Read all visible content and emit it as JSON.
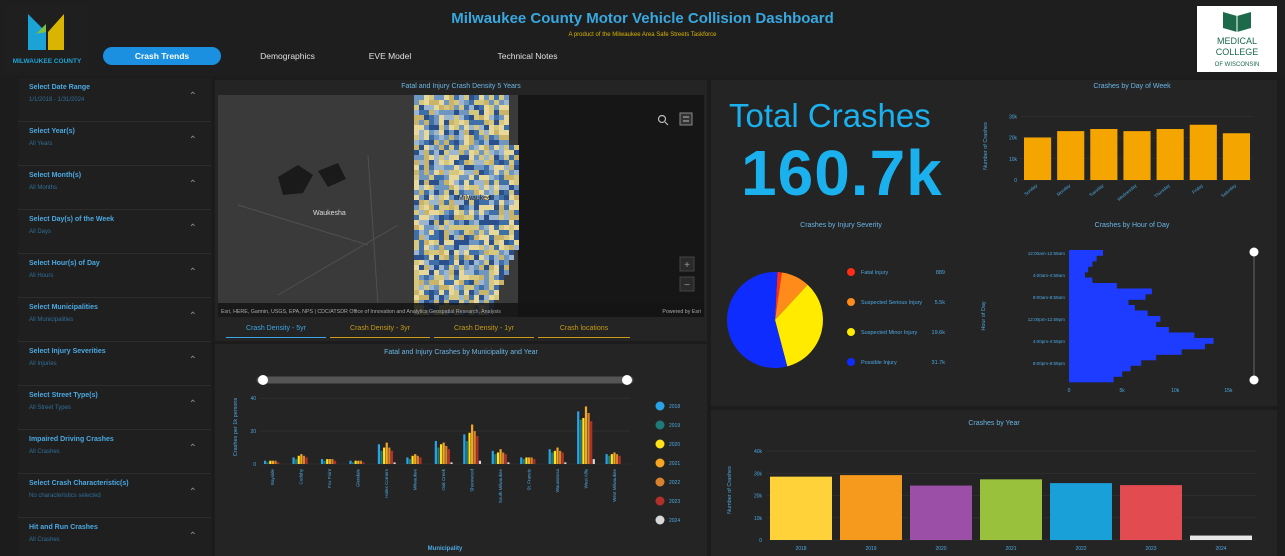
{
  "header": {
    "title": "Milwaukee County Motor Vehicle Collision Dashboard",
    "subtitle": "A product of the Milwaukee Area Safe Streets Taskforce",
    "left_logo_text": "MILWAUKEE COUNTY",
    "right_logo_text": "MEDICAL COLLEGE OF WISCONSIN",
    "tabs": [
      {
        "label": "Crash Trends",
        "active": true
      },
      {
        "label": "Demographics",
        "active": false
      },
      {
        "label": "EVE Model",
        "active": false
      },
      {
        "label": "Technical Notes",
        "active": false
      }
    ]
  },
  "sidebar": {
    "filters": [
      {
        "label": "Select Date Range",
        "value": "1/1/2018 - 1/31/2024"
      },
      {
        "label": "Select Year(s)",
        "value": "All Years"
      },
      {
        "label": "Select Month(s)",
        "value": "All Months"
      },
      {
        "label": "Select Day(s) of the Week",
        "value": "All Days"
      },
      {
        "label": "Select Hour(s) of Day",
        "value": "All Hours"
      },
      {
        "label": "Select Municipalities",
        "value": "All Municipalities"
      },
      {
        "label": "Select Injury Severities",
        "value": "All Injuries"
      },
      {
        "label": "Select Street Type(s)",
        "value": "All Street Types"
      },
      {
        "label": "Impaired Driving Crashes",
        "value": "All Crashes"
      },
      {
        "label": "Select Crash Characteristic(s)",
        "value": "No characteristics selected"
      },
      {
        "label": "Hit and Run Crashes",
        "value": "All Crashes"
      }
    ]
  },
  "map": {
    "title": "Fatal and Injury Crash Density 5 Years",
    "place_waukesha": "Waukesha",
    "place_milwaukee": "Milwaukee",
    "attribution": "Esri, HERE, Garmin, USGS, EPA, NPS | CDC/ATSDR Office of Innovation and Analytics Geospatial Research, Analysis",
    "powered_by": "Powered by Esri",
    "zoom_in": "+",
    "zoom_out": "−",
    "tabs": [
      {
        "label": "Crash Density - 5yr",
        "active": true
      },
      {
        "label": "Crash Density - 3yr",
        "active": false
      },
      {
        "label": "Crash Density - 1yr",
        "active": false
      },
      {
        "label": "Crash locations",
        "active": false
      }
    ]
  },
  "total": {
    "label": "Total Crashes",
    "value": "160.7k"
  },
  "colors": {
    "accent": "#1b8fe0",
    "orange": "#f5a500",
    "blue_bar": "#1e3cff",
    "yellow": "#ffeb00"
  },
  "charts": {
    "day_of_week": {
      "title": "Crashes by Day of Week",
      "ylabel": "Number of Crashes",
      "yticks": [
        "0",
        "10k",
        "20k",
        "30k"
      ],
      "ylim": [
        0,
        32
      ],
      "categories": [
        "Sunday",
        "Monday",
        "Tuesday",
        "Wednesday",
        "Thursday",
        "Friday",
        "Saturday"
      ],
      "values": [
        20,
        23,
        24,
        23,
        24,
        26,
        22
      ]
    },
    "injury_severity": {
      "title": "Crashes by Injury Severity",
      "legend": [
        {
          "label": "Fatal Injury",
          "value": "889",
          "color": "#ff2d16"
        },
        {
          "label": "Suspected Serious Injury",
          "value": "5.5k",
          "color": "#ff8c1a"
        },
        {
          "label": "Suspected Minor Injury",
          "value": "19.6k",
          "color": "#ffeb00"
        },
        {
          "label": "Possible Injury",
          "value": "31.7k",
          "color": "#0f2cff"
        }
      ],
      "shares": [
        1.5,
        9.6,
        34.0,
        54.9
      ]
    },
    "hour_of_day": {
      "title": "Crashes by Hour of Day",
      "ylabel": "Hour of Day",
      "ticks_y": [
        "12:00am-12:59am",
        "4:00am-4:59am",
        "8:00am-8:59am",
        "12:00pm-12:59pm",
        "4:00pm-4:59pm",
        "8:00pm-8:59pm"
      ],
      "ticks_x": [
        "0",
        "5k",
        "10k",
        "15k"
      ],
      "xlim": [
        0,
        16
      ],
      "values": [
        3.2,
        2.6,
        2.2,
        1.8,
        1.5,
        2.2,
        4.5,
        7.8,
        7.2,
        5.6,
        6.2,
        7.4,
        8.6,
        8.2,
        9.4,
        11.8,
        13.6,
        12.8,
        10.6,
        8.2,
        6.8,
        5.8,
        5.0,
        4.2
      ]
    },
    "municipality_year": {
      "title": "Fatal and Injury Crashes by Municipality and Year",
      "xlabel": "Municipality",
      "ylabel": "Crashes per 1k persons",
      "yticks": [
        "0",
        "20",
        "40"
      ],
      "ylim": [
        0,
        45
      ],
      "years": [
        "2018",
        "2019",
        "2020",
        "2021",
        "2022",
        "2023",
        "2024"
      ],
      "colors": [
        "#29a3e6",
        "#1f7a7a",
        "#ffe21a",
        "#f5a623",
        "#d9822b",
        "#b3302a",
        "#d8d8d8"
      ],
      "categories": [
        "Bayside",
        "Cudahy",
        "Fox Point",
        "Glendale",
        "Hales Corners",
        "Milwaukee",
        "Oak Creek",
        "Shorewood",
        "South Milwaukee",
        "St. Francis",
        "Wauwatosa",
        "West Allis",
        "West Milwaukee"
      ],
      "group_values": [
        [
          2,
          1,
          2,
          2,
          2,
          1,
          0
        ],
        [
          4,
          3,
          5,
          6,
          5,
          4,
          0
        ],
        [
          3,
          2,
          3,
          3,
          3,
          2,
          0
        ],
        [
          2,
          1,
          2,
          2,
          2,
          1,
          0
        ],
        [
          12,
          8,
          10,
          13,
          10,
          8,
          1
        ],
        [
          4,
          3,
          5,
          6,
          5,
          4,
          0
        ],
        [
          14,
          10,
          12,
          13,
          11,
          9,
          1
        ],
        [
          18,
          14,
          19,
          24,
          20,
          17,
          2
        ],
        [
          8,
          6,
          7,
          9,
          7,
          6,
          1
        ],
        [
          4,
          3,
          4,
          4,
          4,
          3,
          0
        ],
        [
          9,
          7,
          8,
          10,
          8,
          7,
          1
        ],
        [
          32,
          27,
          28,
          35,
          31,
          26,
          3
        ],
        [
          6,
          5,
          6,
          7,
          6,
          5,
          0
        ]
      ]
    },
    "by_year": {
      "title": "Crashes by Year",
      "ylabel": "Number of Crashes",
      "yticks": [
        "0",
        "10k",
        "20k",
        "30k",
        "40k"
      ],
      "ylim": [
        0,
        45
      ],
      "categories": [
        "2018",
        "2019",
        "2020",
        "2021",
        "2022",
        "2023",
        "2024"
      ],
      "values": [
        28.5,
        29.2,
        24.5,
        27.3,
        25.6,
        24.7,
        2.0
      ],
      "colors": [
        "#ffd23a",
        "#f59a1c",
        "#9b4fa6",
        "#99c13c",
        "#1aa0d8",
        "#e24b4f",
        "#e8e8e8"
      ]
    }
  }
}
